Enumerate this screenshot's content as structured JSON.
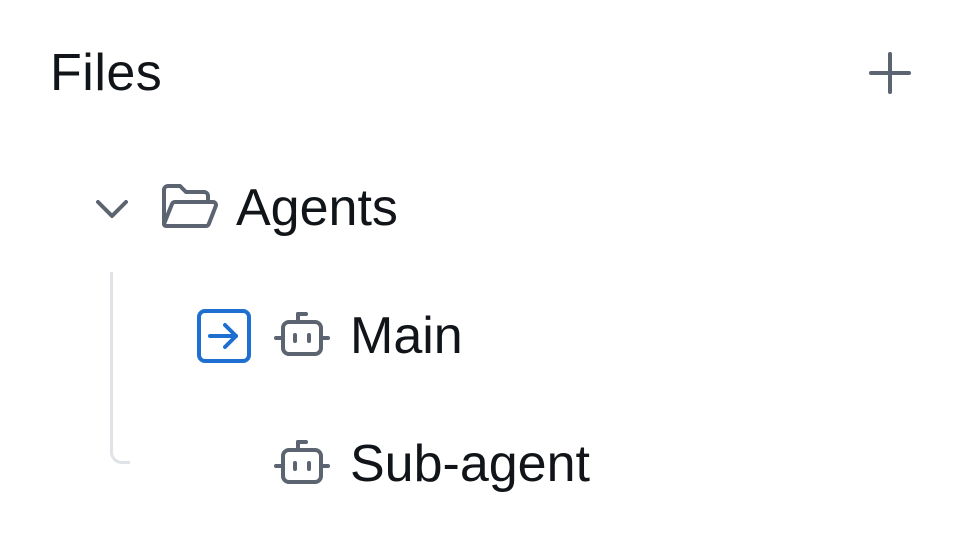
{
  "header": {
    "title": "Files",
    "add_icon": "plus-icon"
  },
  "tree": {
    "folder": {
      "label": "Agents",
      "expanded": true,
      "chevron_icon": "chevron-down-icon",
      "folder_icon": "folder-open-icon"
    },
    "items": [
      {
        "label": "Main",
        "icon": "bot-icon",
        "entry_icon": "arrow-right-to-box-icon",
        "is_entry": true
      },
      {
        "label": "Sub-agent",
        "icon": "bot-icon",
        "is_entry": false
      }
    ]
  },
  "colors": {
    "text": "#111418",
    "icon": "#5b6470",
    "accent": "#1f6fd1",
    "guide_line": "#dfe2e6"
  }
}
